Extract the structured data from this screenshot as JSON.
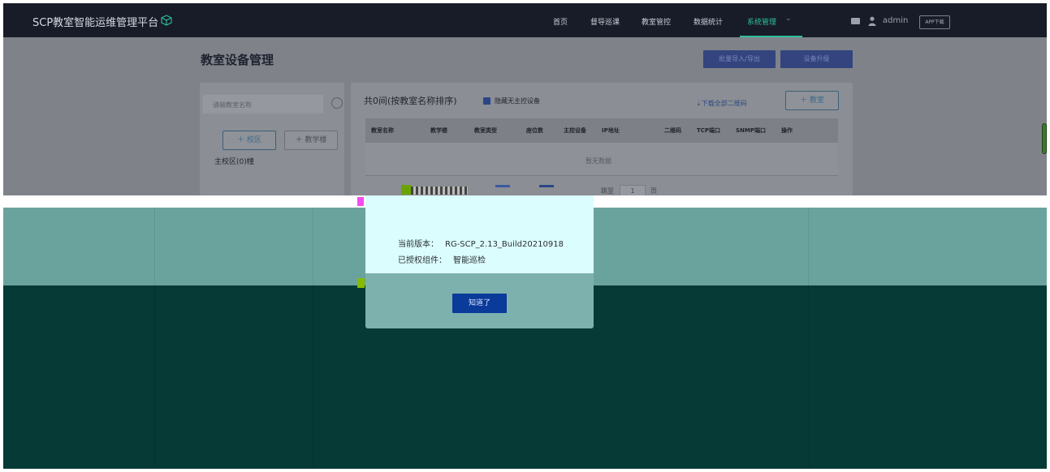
{
  "topbar": {
    "brand": "SCP教室智能运维管理平台",
    "nav": [
      "首页",
      "督导巡课",
      "教室管控",
      "数据统计",
      "系统管理"
    ],
    "user": "admin",
    "app_download": "APP下载"
  },
  "page": {
    "title": "教室设备管理",
    "import_export": "批量导入/导出",
    "upgrade": "设备升级",
    "search_placeholder": "请输教室名称",
    "add_campus": "＋ 校区",
    "add_building": "＋ 教学楼",
    "campus_item": "主校区(0)幢",
    "count_text": "共0间(按教室名称排序)",
    "hide_checkbox": "隐藏无主控设备",
    "download_qr": "下载全部二维码",
    "add_classroom": "＋ 教室",
    "columns": [
      "教室名称",
      "教学楼",
      "教室类型",
      "座位数",
      "主控设备",
      "IP地址",
      "二维码",
      "TCP端口",
      "SNMP端口",
      "操作"
    ],
    "empty": "暂无数据",
    "pager_goto": "跳至",
    "pager_value": "1",
    "pager_page": "页"
  },
  "modal": {
    "version_label": "当前版本：",
    "version_value": "RG-SCP_2.13_Build20210918",
    "license_label": "已授权组件：",
    "license_value": "智能巡检",
    "ok": "知道了"
  },
  "colors": {
    "accent": "#2fbf9a",
    "primary_button": "#0a3a9a"
  }
}
